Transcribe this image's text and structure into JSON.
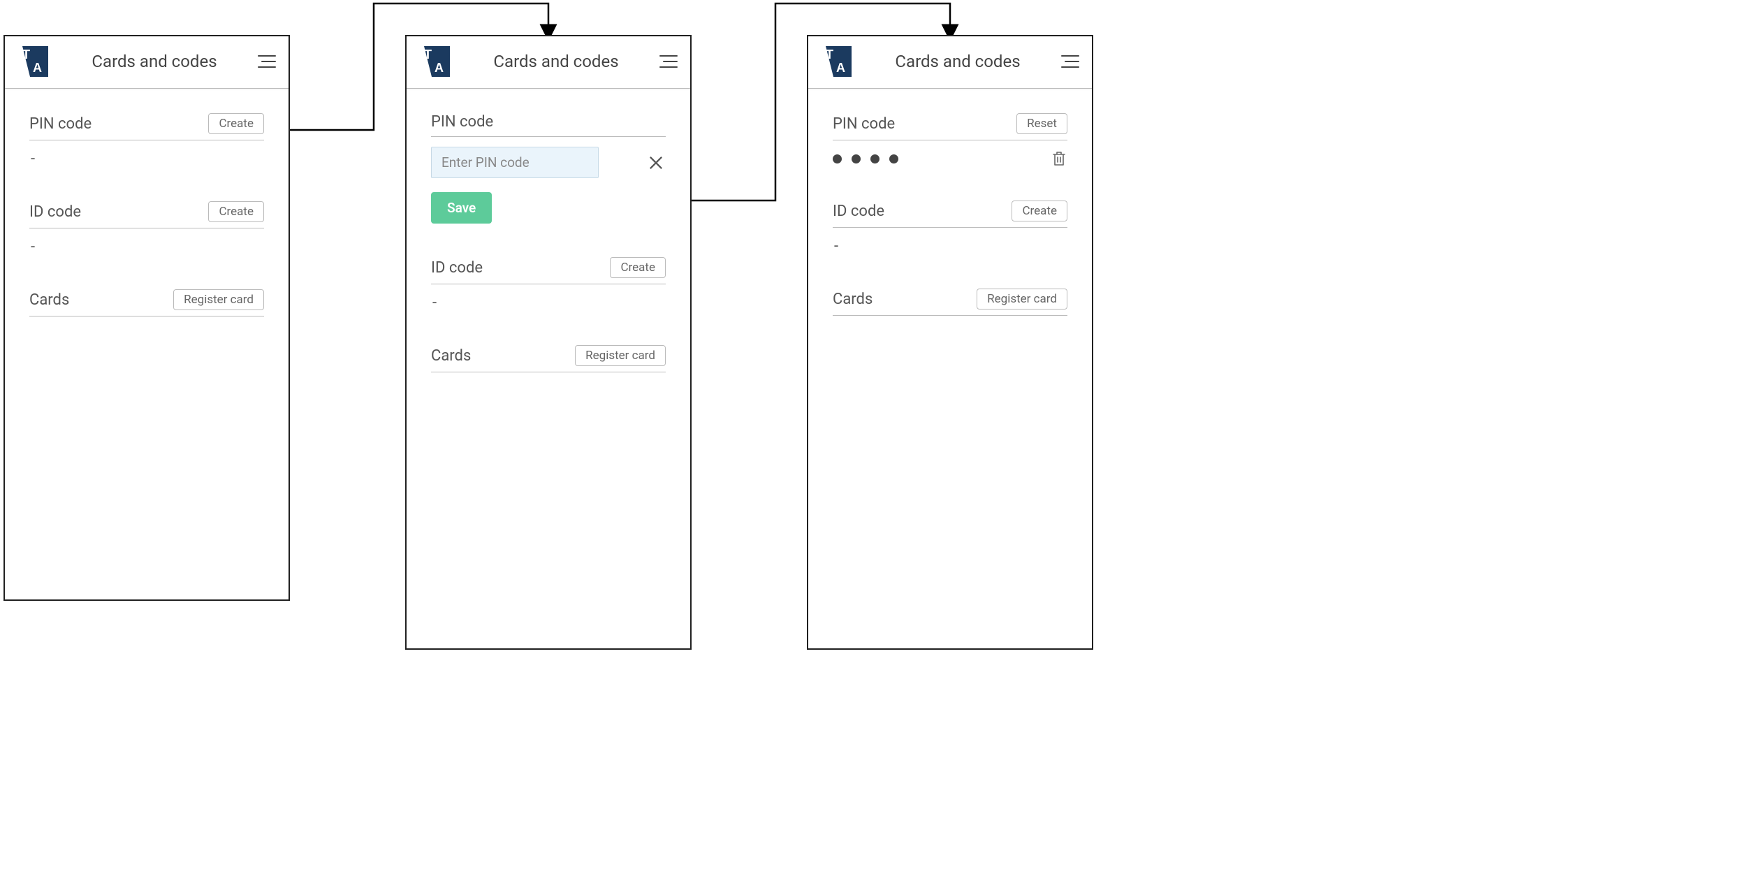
{
  "header_title": "Cards and codes",
  "screen1": {
    "pin": {
      "label": "PIN code",
      "button": "Create",
      "value": "-"
    },
    "id": {
      "label": "ID code",
      "button": "Create",
      "value": "-"
    },
    "cards": {
      "label": "Cards",
      "button": "Register card"
    }
  },
  "screen2": {
    "pin": {
      "label": "PIN code",
      "placeholder": "Enter PIN code",
      "save": "Save"
    },
    "id": {
      "label": "ID code",
      "button": "Create",
      "value": "-"
    },
    "cards": {
      "label": "Cards",
      "button": "Register card"
    }
  },
  "screen3": {
    "pin": {
      "label": "PIN code",
      "button": "Reset"
    },
    "id": {
      "label": "ID code",
      "button": "Create",
      "value": "-"
    },
    "cards": {
      "label": "Cards",
      "button": "Register card"
    }
  }
}
